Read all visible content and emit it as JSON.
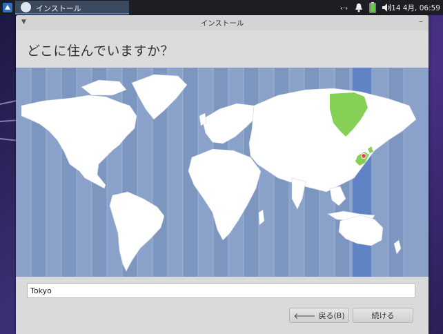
{
  "panel": {
    "task_title": "インストール",
    "clock": "14 4月, 06:59",
    "tray_icons": [
      "network-icon",
      "notification-bell-icon",
      "battery-icon",
      "volume-icon"
    ]
  },
  "window": {
    "title": "インストール",
    "heading": "どこに住んでいますか？"
  },
  "map": {
    "selected_timezone_highlight": "#5f83c4",
    "selected_country_color": "#86d055",
    "marker_color": "#e14b4b"
  },
  "location": {
    "value": "Tokyo"
  },
  "buttons": {
    "back_label": "戻る(B)",
    "continue_label": "続ける"
  }
}
